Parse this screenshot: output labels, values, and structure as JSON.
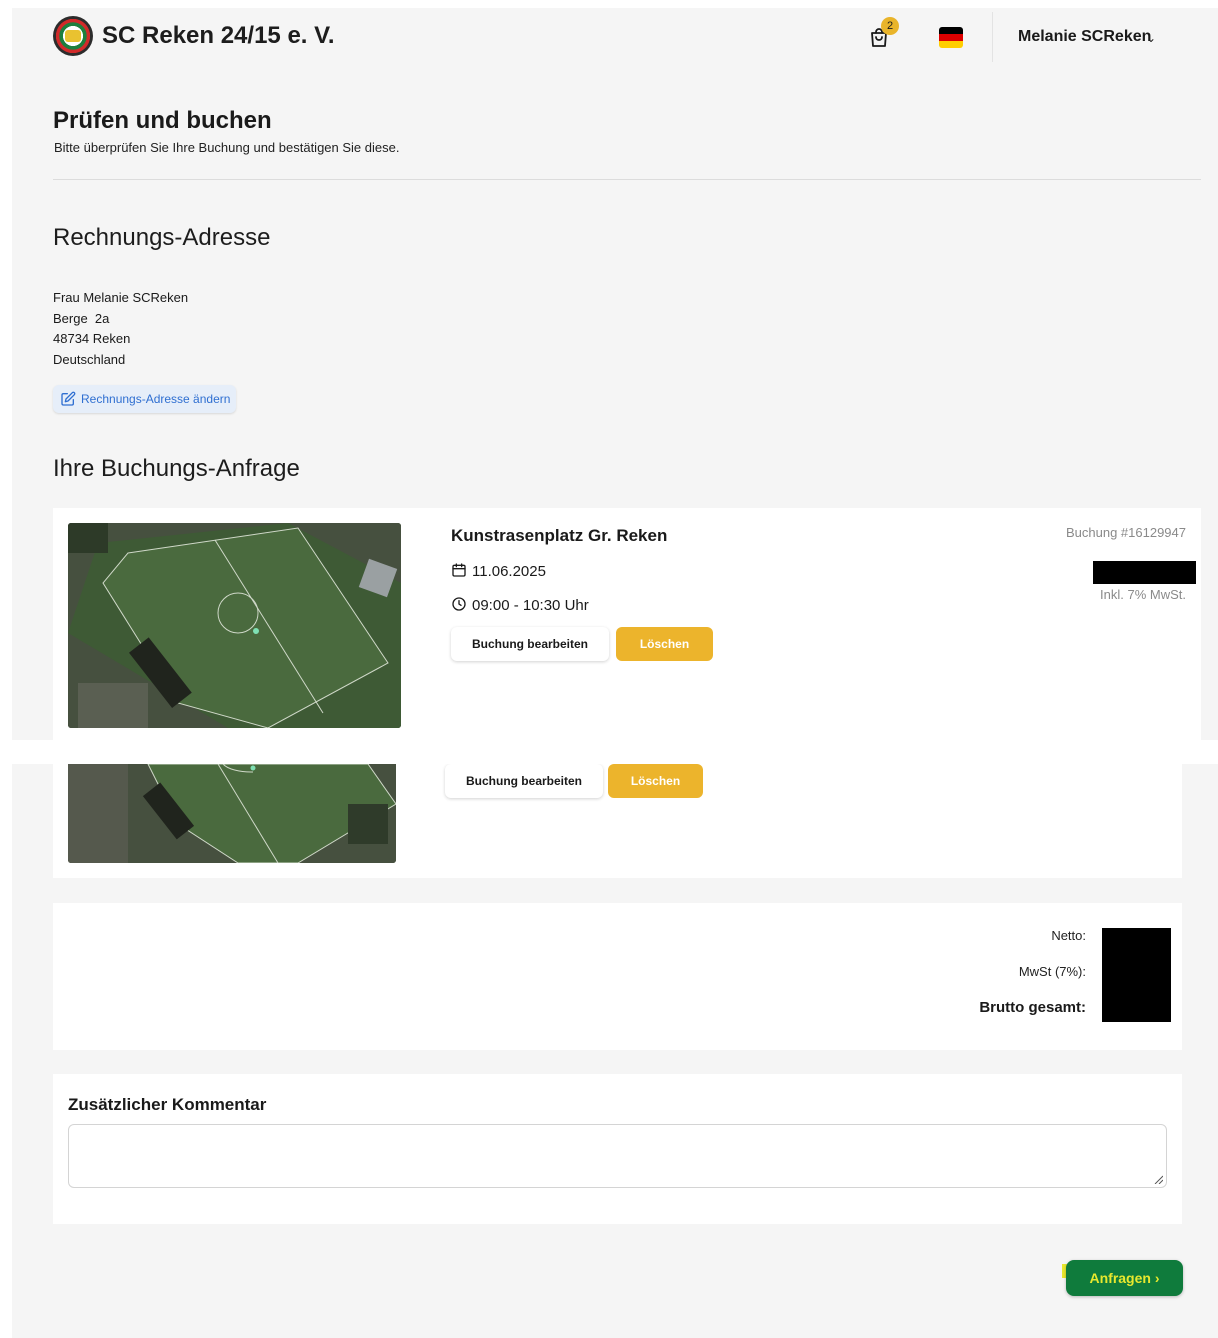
{
  "header": {
    "brand": "SC Reken 24/15 e. V.",
    "cart_count": "2",
    "user_name": "Melanie SCReken",
    "user_chevron": "⌄",
    "flag_colors": [
      "#000000",
      "#dd0000",
      "#ffce00"
    ]
  },
  "page": {
    "title": "Prüfen und buchen",
    "subtitle": "Bitte überprüfen Sie Ihre Buchung und bestätigen Sie diese."
  },
  "billing": {
    "heading": "Rechnungs-Adresse",
    "lines": [
      "Frau Melanie SCReken",
      "Berge  2a",
      "48734 Reken",
      "Deutschland"
    ],
    "edit_label": "Rechnungs-Adresse ändern"
  },
  "booking": {
    "heading": "Ihre Buchungs-Anfrage",
    "venue": "Kunstrasenplatz Gr. Reken",
    "date": "11.06.2025",
    "time": "09:00 - 10:30 Uhr",
    "edit_label": "Buchung bearbeiten",
    "delete_label": "Löschen",
    "number": "Buchung #16129947",
    "tax_note": "Inkl. 7% MwSt."
  },
  "totals": {
    "net_label": "Netto:",
    "vat_label": "MwSt (7%):",
    "gross_label": "Brutto gesamt:"
  },
  "comment": {
    "heading": "Zusätzlicher Kommentar",
    "value": ""
  },
  "actions": {
    "submit_label": "Anfragen ›"
  },
  "colors": {
    "accent_yellow": "#ecb42c",
    "submit_green": "#0f7b3c",
    "link_blue": "#2f6fd1"
  }
}
